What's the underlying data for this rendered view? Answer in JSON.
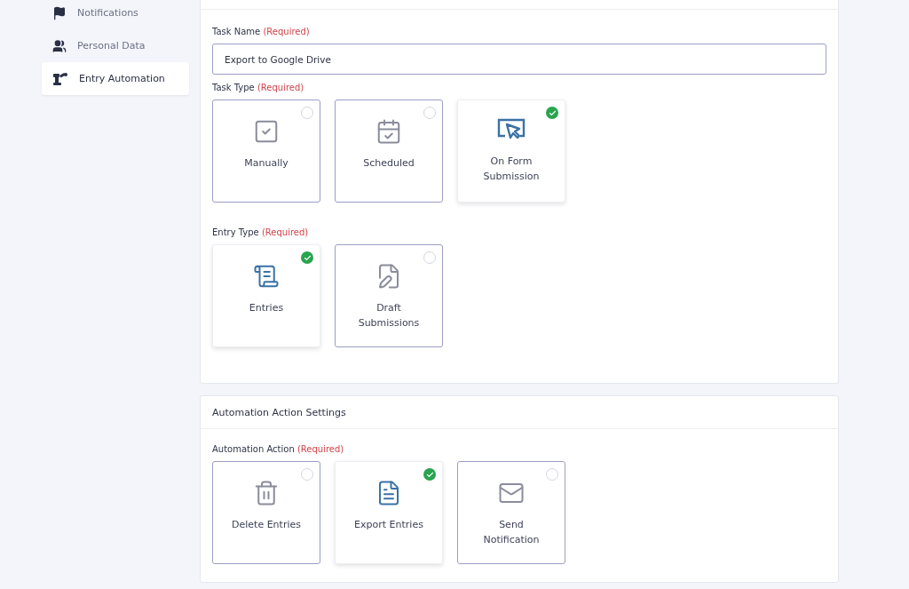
{
  "sidebar": {
    "items": [
      {
        "label": "Notifications",
        "selected": false
      },
      {
        "label": "Personal Data",
        "selected": false
      },
      {
        "label": "Entry Automation",
        "selected": true
      }
    ]
  },
  "task_panel": {
    "task_name": {
      "label": "Task Name",
      "required_note": "(Required)",
      "value": "Export to Google Drive"
    },
    "task_type": {
      "label": "Task Type",
      "required_note": "(Required)",
      "options": [
        {
          "label": "Manually",
          "selected": false
        },
        {
          "label": "Scheduled",
          "selected": false
        },
        {
          "label": "On Form Submission",
          "selected": true
        }
      ]
    },
    "entry_type": {
      "label": "Entry Type",
      "required_note": "(Required)",
      "options": [
        {
          "label": "Entries",
          "selected": true
        },
        {
          "label": "Draft Submissions",
          "selected": false
        }
      ]
    }
  },
  "action_panel": {
    "title": "Automation Action Settings",
    "automation_action": {
      "label": "Automation Action",
      "required_note": "(Required)",
      "options": [
        {
          "label": "Delete Entries",
          "selected": false
        },
        {
          "label": "Export Entries",
          "selected": true
        },
        {
          "label": "Send Notification",
          "selected": false
        }
      ]
    }
  }
}
